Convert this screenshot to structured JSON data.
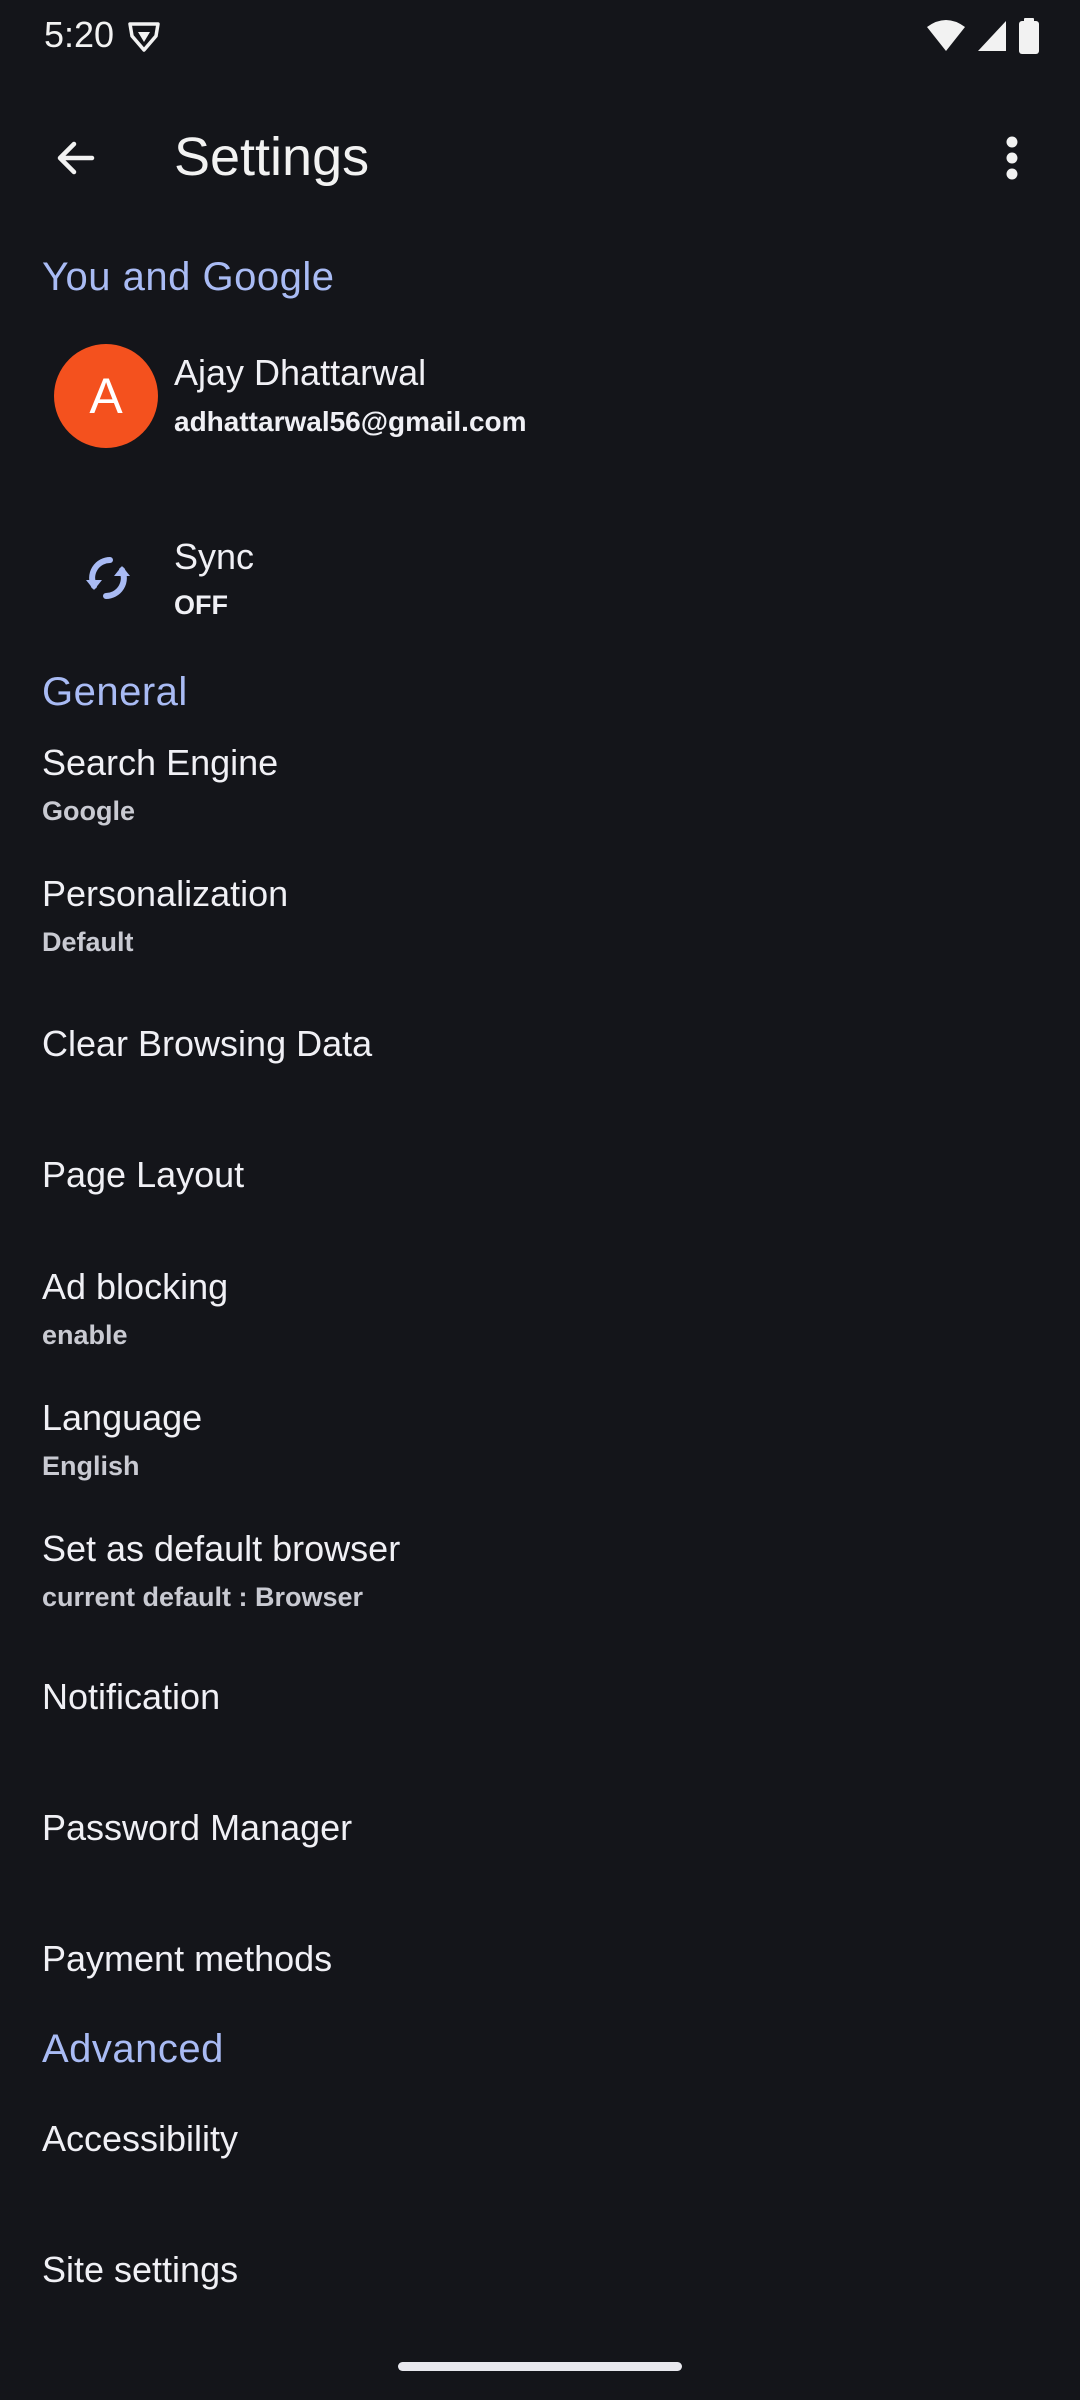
{
  "status_bar": {
    "time": "5:20",
    "icons": [
      "brave-lion-icon",
      "wifi-icon",
      "cell-signal-icon",
      "battery-icon"
    ]
  },
  "app_bar": {
    "title": "Settings",
    "back_icon": "arrow-back-icon",
    "more_icon": "more-vert-icon"
  },
  "sections": {
    "you_and_google": "You and Google",
    "general": "General",
    "advanced": "Advanced"
  },
  "account": {
    "initial": "A",
    "name": "Ajay Dhattarwal",
    "email": "adhattarwal56@gmail.com",
    "avatar_color": "#f4511e"
  },
  "sync": {
    "title": "Sync",
    "status": "OFF"
  },
  "general_items": [
    {
      "title": "Search Engine",
      "subtitle": "Google"
    },
    {
      "title": "Personalization",
      "subtitle": "Default"
    },
    {
      "title": "Clear Browsing Data"
    },
    {
      "title": "Page Layout"
    },
    {
      "title": "Ad blocking",
      "subtitle": "enable"
    },
    {
      "title": "Language",
      "subtitle": "English"
    },
    {
      "title": "Set as default browser",
      "subtitle": "current default : Browser"
    },
    {
      "title": "Notification"
    },
    {
      "title": "Password Manager"
    },
    {
      "title": "Payment methods"
    }
  ],
  "advanced_items": [
    {
      "title": "Accessibility"
    },
    {
      "title": "Site settings"
    }
  ],
  "colors": {
    "background": "#14151a",
    "accent": "#a9bbf4",
    "text": "#f0f0f5"
  }
}
